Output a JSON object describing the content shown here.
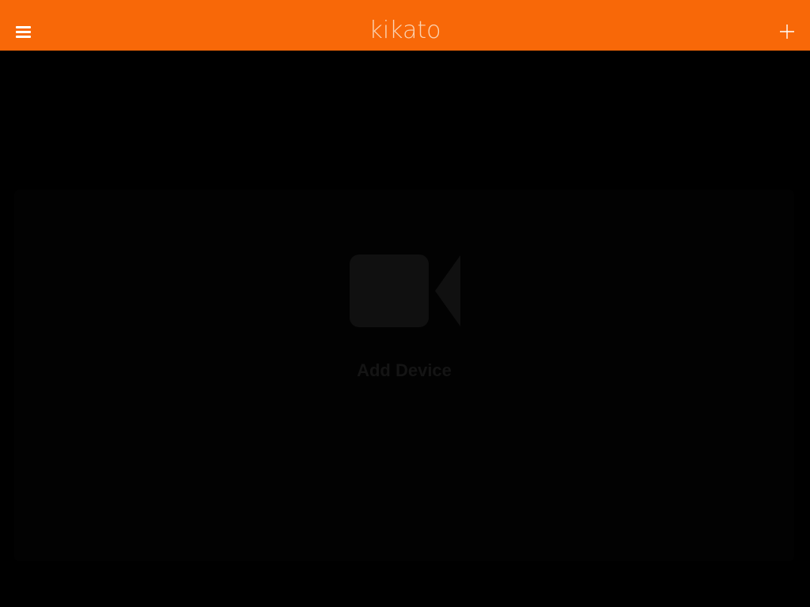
{
  "header": {
    "brand": "kikato",
    "background_color": "#f86808",
    "menu_icon": "hamburger-menu-icon",
    "add_icon": "plus-icon"
  },
  "main": {
    "add_device": {
      "label": "Add Device",
      "icon": "video-camera-icon",
      "icon_color": "#101010",
      "label_color": "#141414"
    }
  }
}
